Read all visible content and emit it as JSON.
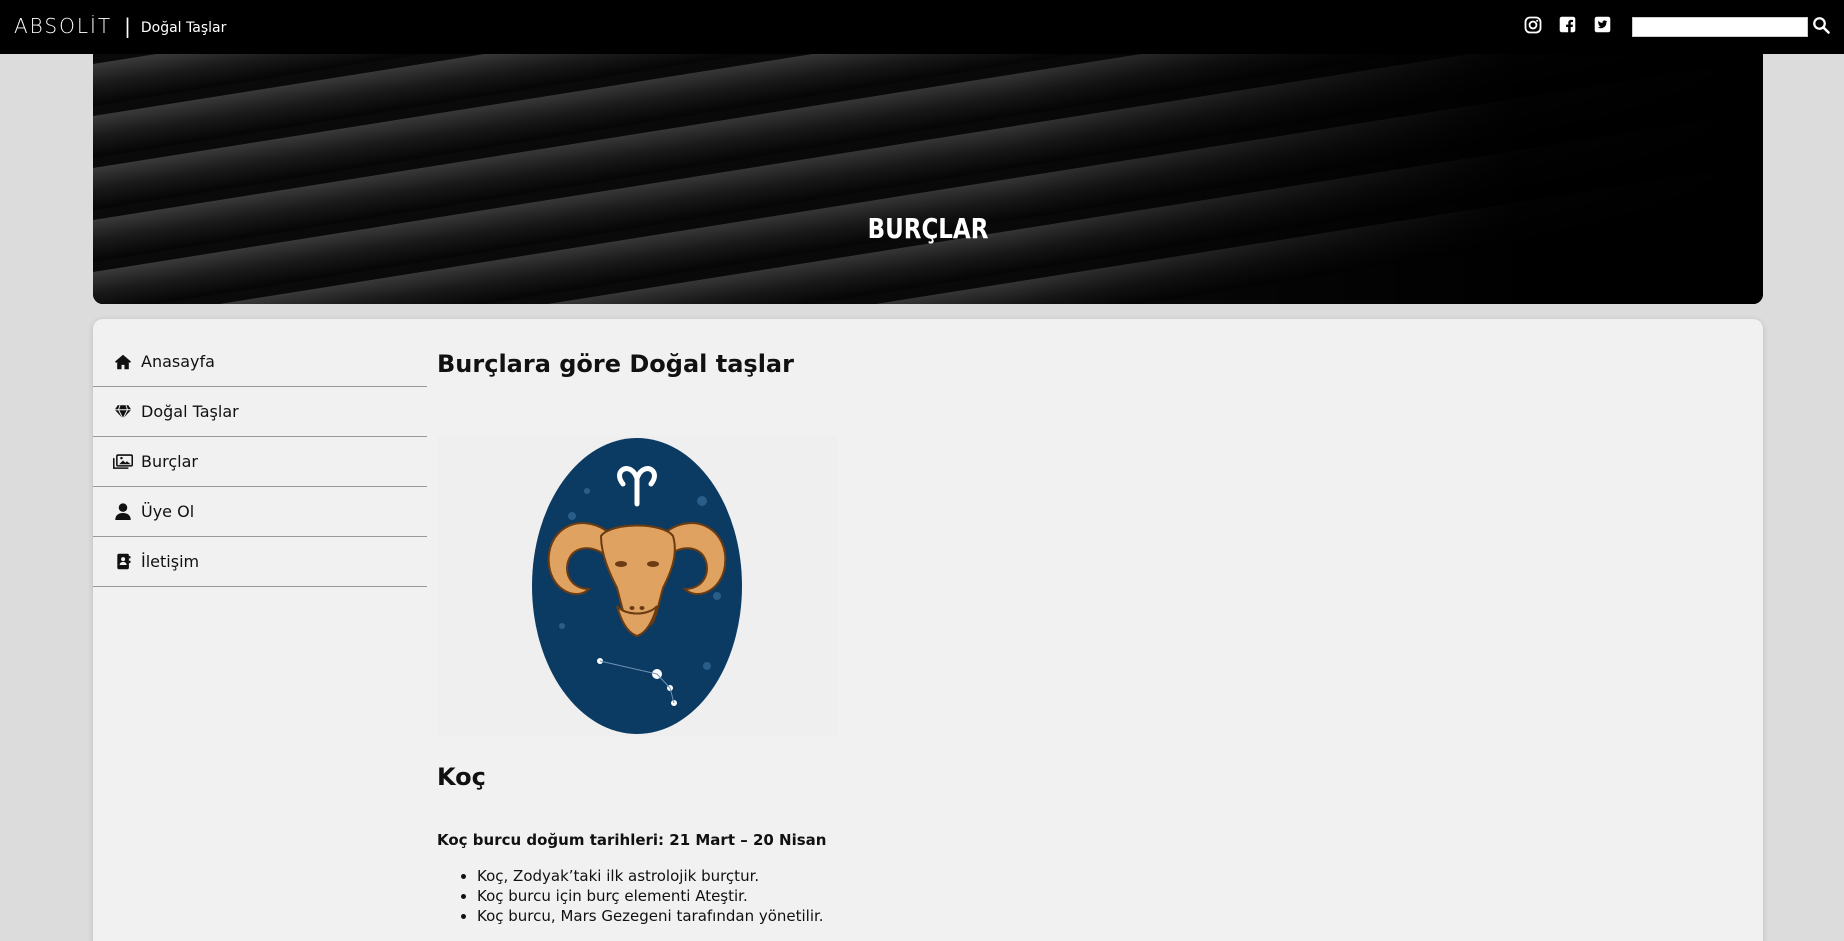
{
  "topbar": {
    "brand": "ABSOLİT",
    "separator": "|",
    "subtitle": "Doğal Taşlar",
    "social": [
      "instagram-icon",
      "facebook-icon",
      "twitter-icon"
    ],
    "search_value": "",
    "search_icon": "search-icon"
  },
  "banner": {
    "title": "BURÇLAR"
  },
  "sidebar": {
    "items": [
      {
        "label": "Anasayfa",
        "icon": "home-icon"
      },
      {
        "label": "Doğal Taşlar",
        "icon": "diamond-icon"
      },
      {
        "label": "Burçlar",
        "icon": "images-icon"
      },
      {
        "label": "Üye Ol",
        "icon": "user-icon"
      },
      {
        "label": "İletişim",
        "icon": "contact-book-icon"
      }
    ]
  },
  "main": {
    "heading": "Burçlara göre Doğal taşlar",
    "sign": {
      "title": "Koç",
      "symbol": "♈",
      "dates": "Koç burcu doğum tarihleri: 21 Mart – 20 Nisan",
      "facts": [
        "Koç, Zodyak’taki ilk astrolojik burçtur.",
        "Koç burcu için burç elementi Ateştir.",
        "Koç burcu, Mars Gezegeni tarafından yönetilir."
      ]
    }
  },
  "colors": {
    "topbar": "#000000",
    "page_bg": "#dcdcdc",
    "card_bg": "#f1f1f1",
    "zodiac_oval": "#0b3a62",
    "ram_gold": "#e0a260"
  }
}
